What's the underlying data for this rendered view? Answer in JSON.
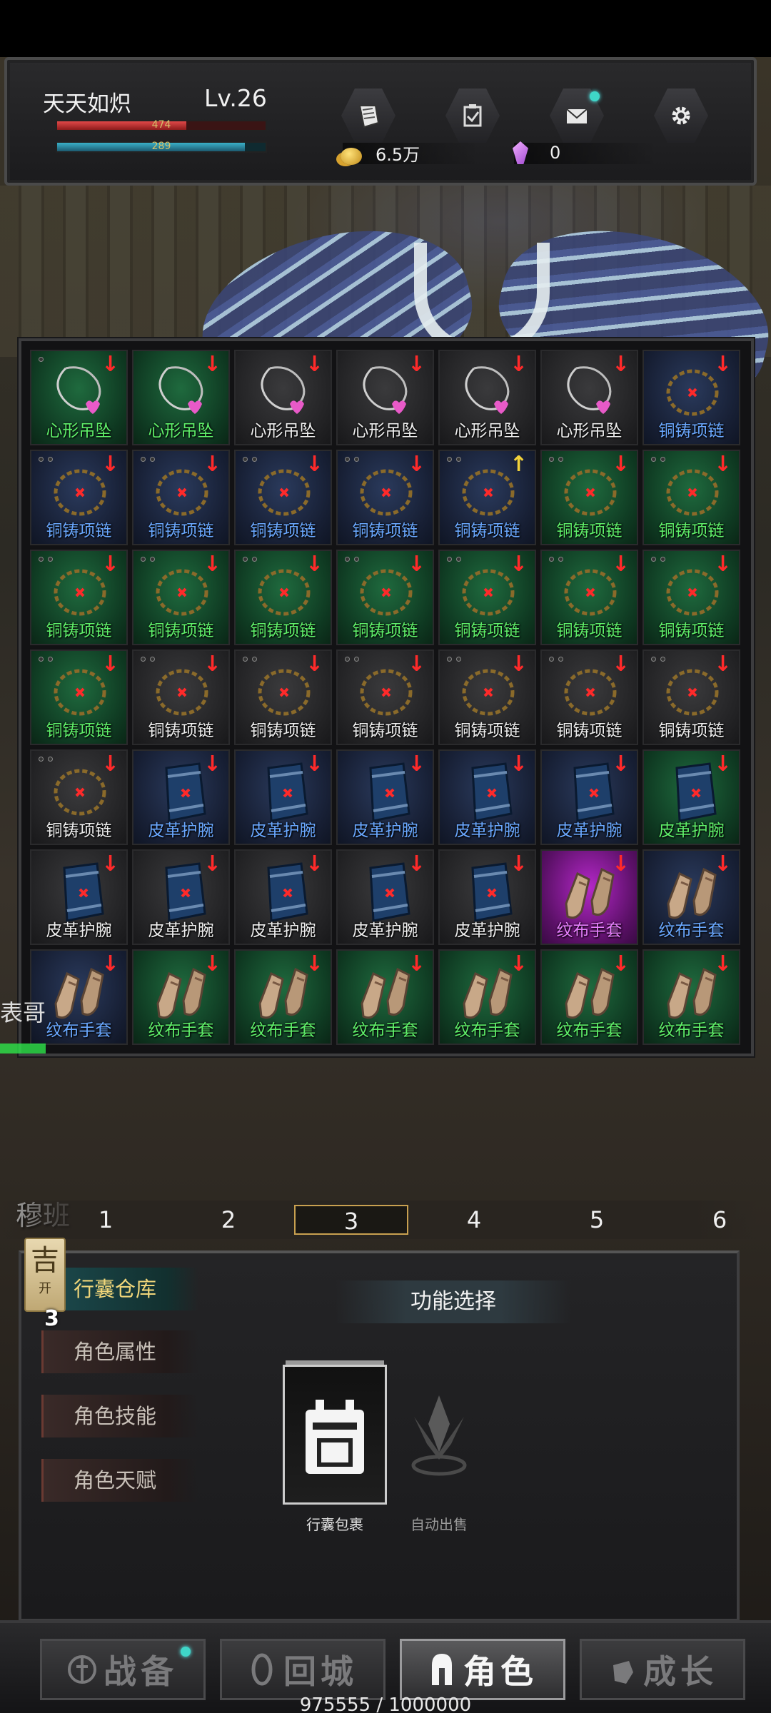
{
  "player": {
    "name": "天天如炽",
    "level": "Lv.26",
    "hp_text": "474",
    "mp_text": "289",
    "hp_fraction": 0.62,
    "mp_fraction": 0.9
  },
  "hud": {
    "buttons": [
      {
        "name": "quest-scroll-icon"
      },
      {
        "name": "checklist-icon"
      },
      {
        "name": "mail-icon",
        "notify": true
      },
      {
        "name": "gear-icon"
      }
    ],
    "gold": "6.5万",
    "gems": "0"
  },
  "inventory": {
    "items": [
      {
        "name": "心形吊坠",
        "rarity": "green",
        "kind": "pendant",
        "arrow": "down",
        "dots": 1
      },
      {
        "name": "心形吊坠",
        "rarity": "green",
        "kind": "pendant",
        "arrow": "down",
        "dots": 0
      },
      {
        "name": "心形吊坠",
        "rarity": "white",
        "kind": "pendant",
        "arrow": "down",
        "dots": 0
      },
      {
        "name": "心形吊坠",
        "rarity": "white",
        "kind": "pendant",
        "arrow": "down",
        "dots": 0
      },
      {
        "name": "心形吊坠",
        "rarity": "white",
        "kind": "pendant",
        "arrow": "down",
        "dots": 0
      },
      {
        "name": "心形吊坠",
        "rarity": "white",
        "kind": "pendant",
        "arrow": "down",
        "dots": 0
      },
      {
        "name": "铜铸项链",
        "rarity": "blue",
        "kind": "necklace",
        "arrow": "down",
        "dots": 0
      },
      {
        "name": "铜铸项链",
        "rarity": "blue",
        "kind": "necklace",
        "arrow": "down",
        "dots": 2
      },
      {
        "name": "铜铸项链",
        "rarity": "blue",
        "kind": "necklace",
        "arrow": "down",
        "dots": 2
      },
      {
        "name": "铜铸项链",
        "rarity": "blue",
        "kind": "necklace",
        "arrow": "down",
        "dots": 2
      },
      {
        "name": "铜铸项链",
        "rarity": "blue",
        "kind": "necklace",
        "arrow": "down",
        "dots": 2
      },
      {
        "name": "铜铸项链",
        "rarity": "blue",
        "kind": "necklace",
        "arrow": "up",
        "dots": 2
      },
      {
        "name": "铜铸项链",
        "rarity": "green",
        "kind": "necklace",
        "arrow": "down",
        "dots": 2
      },
      {
        "name": "铜铸项链",
        "rarity": "green",
        "kind": "necklace",
        "arrow": "down",
        "dots": 2
      },
      {
        "name": "铜铸项链",
        "rarity": "green",
        "kind": "necklace",
        "arrow": "down",
        "dots": 2
      },
      {
        "name": "铜铸项链",
        "rarity": "green",
        "kind": "necklace",
        "arrow": "down",
        "dots": 2
      },
      {
        "name": "铜铸项链",
        "rarity": "green",
        "kind": "necklace",
        "arrow": "down",
        "dots": 2
      },
      {
        "name": "铜铸项链",
        "rarity": "green",
        "kind": "necklace",
        "arrow": "down",
        "dots": 2
      },
      {
        "name": "铜铸项链",
        "rarity": "green",
        "kind": "necklace",
        "arrow": "down",
        "dots": 2
      },
      {
        "name": "铜铸项链",
        "rarity": "green",
        "kind": "necklace",
        "arrow": "down",
        "dots": 2
      },
      {
        "name": "铜铸项链",
        "rarity": "green",
        "kind": "necklace",
        "arrow": "down",
        "dots": 2
      },
      {
        "name": "铜铸项链",
        "rarity": "green",
        "kind": "necklace",
        "arrow": "down",
        "dots": 2
      },
      {
        "name": "铜铸项链",
        "rarity": "white",
        "kind": "necklace",
        "arrow": "down",
        "dots": 2
      },
      {
        "name": "铜铸项链",
        "rarity": "white",
        "kind": "necklace",
        "arrow": "down",
        "dots": 2
      },
      {
        "name": "铜铸项链",
        "rarity": "white",
        "kind": "necklace",
        "arrow": "down",
        "dots": 2
      },
      {
        "name": "铜铸项链",
        "rarity": "white",
        "kind": "necklace",
        "arrow": "down",
        "dots": 2
      },
      {
        "name": "铜铸项链",
        "rarity": "white",
        "kind": "necklace",
        "arrow": "down",
        "dots": 2
      },
      {
        "name": "铜铸项链",
        "rarity": "white",
        "kind": "necklace",
        "arrow": "down",
        "dots": 2
      },
      {
        "name": "铜铸项链",
        "rarity": "white",
        "kind": "necklace",
        "arrow": "down",
        "dots": 2
      },
      {
        "name": "皮革护腕",
        "rarity": "blue",
        "kind": "bracer",
        "arrow": "down",
        "dots": 0
      },
      {
        "name": "皮革护腕",
        "rarity": "blue",
        "kind": "bracer",
        "arrow": "down",
        "dots": 0
      },
      {
        "name": "皮革护腕",
        "rarity": "blue",
        "kind": "bracer",
        "arrow": "down",
        "dots": 0
      },
      {
        "name": "皮革护腕",
        "rarity": "blue",
        "kind": "bracer",
        "arrow": "down",
        "dots": 0
      },
      {
        "name": "皮革护腕",
        "rarity": "blue",
        "kind": "bracer",
        "arrow": "down",
        "dots": 0
      },
      {
        "name": "皮革护腕",
        "rarity": "green",
        "kind": "bracer",
        "arrow": "down",
        "dots": 0
      },
      {
        "name": "皮革护腕",
        "rarity": "white",
        "kind": "bracer",
        "arrow": "down",
        "dots": 0
      },
      {
        "name": "皮革护腕",
        "rarity": "white",
        "kind": "bracer",
        "arrow": "down",
        "dots": 0
      },
      {
        "name": "皮革护腕",
        "rarity": "white",
        "kind": "bracer",
        "arrow": "down",
        "dots": 0
      },
      {
        "name": "皮革护腕",
        "rarity": "white",
        "kind": "bracer",
        "arrow": "down",
        "dots": 0
      },
      {
        "name": "皮革护腕",
        "rarity": "white",
        "kind": "bracer",
        "arrow": "down",
        "dots": 0
      },
      {
        "name": "纹布手套",
        "rarity": "purple",
        "kind": "glove",
        "arrow": "down",
        "dots": 0
      },
      {
        "name": "纹布手套",
        "rarity": "blue",
        "kind": "glove",
        "arrow": "down",
        "dots": 0
      },
      {
        "name": "纹布手套",
        "rarity": "blue",
        "kind": "glove",
        "arrow": "down",
        "dots": 0
      },
      {
        "name": "纹布手套",
        "rarity": "green",
        "kind": "glove",
        "arrow": "down",
        "dots": 0
      },
      {
        "name": "纹布手套",
        "rarity": "green",
        "kind": "glove",
        "arrow": "down",
        "dots": 0
      },
      {
        "name": "纹布手套",
        "rarity": "green",
        "kind": "glove",
        "arrow": "down",
        "dots": 0
      },
      {
        "name": "纹布手套",
        "rarity": "green",
        "kind": "glove",
        "arrow": "down",
        "dots": 0
      },
      {
        "name": "纹布手套",
        "rarity": "green",
        "kind": "glove",
        "arrow": "down",
        "dots": 0
      },
      {
        "name": "纹布手套",
        "rarity": "green",
        "kind": "glove",
        "arrow": "down",
        "dots": 0
      }
    ],
    "rarity_colors": {
      "green": "#5ff06a",
      "blue": "#6aa8ff",
      "white": "#eeeeee",
      "purple": "#e880ff"
    },
    "arrow_colors": {
      "down": "#ff2a2a",
      "up": "#f2d23a"
    }
  },
  "scene": {
    "side_text": "表哥",
    "map_name": "穆班"
  },
  "page_tabs": {
    "labels": [
      "1",
      "2",
      "3",
      "4",
      "5",
      "6"
    ],
    "active": "3"
  },
  "badge": {
    "glyph": "吉",
    "sub": "开",
    "number": "3"
  },
  "panel": {
    "title": "功能选择",
    "menu": [
      {
        "label": "行囊仓库",
        "active": true
      },
      {
        "label": "角色属性",
        "active": false
      },
      {
        "label": "角色技能",
        "active": false
      },
      {
        "label": "角色天赋",
        "active": false
      }
    ],
    "features": [
      {
        "label": "行囊包裹",
        "active": true
      },
      {
        "label": "自动出售",
        "active": false
      }
    ]
  },
  "bottom_nav": {
    "items": [
      {
        "label": "战备",
        "icon": "helm-emblem-icon",
        "notify": true,
        "active": false
      },
      {
        "label": "回城",
        "icon": "return-portal-icon",
        "notify": false,
        "active": false
      },
      {
        "label": "角色",
        "icon": "knight-helmet-icon",
        "notify": false,
        "active": true
      },
      {
        "label": "成长",
        "icon": "growth-fist-icon",
        "notify": false,
        "active": false
      }
    ],
    "exp_text": "975555 / 1000000"
  }
}
